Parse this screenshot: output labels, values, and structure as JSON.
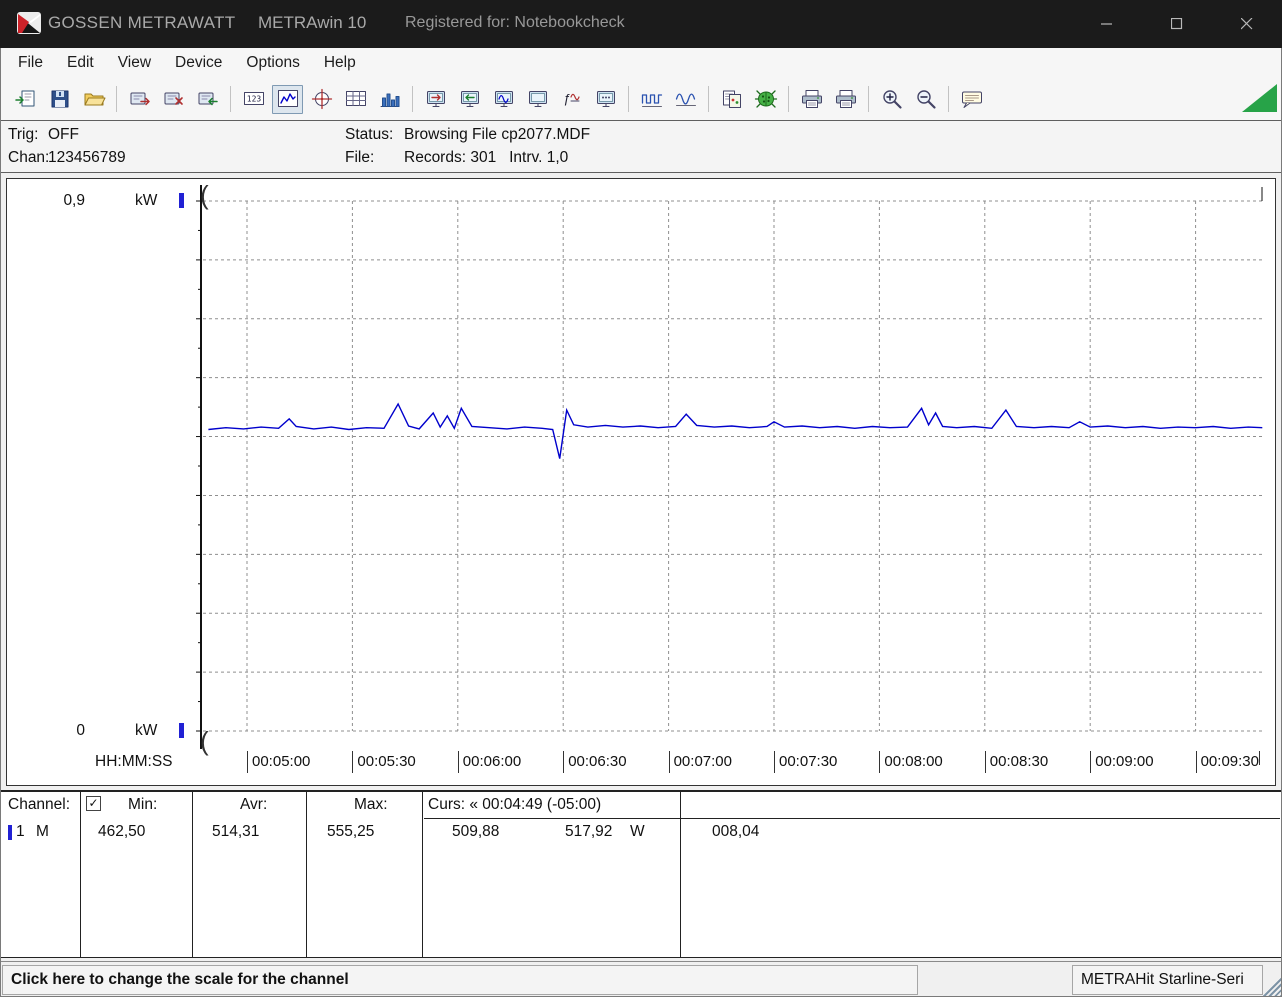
{
  "titlebar": {
    "brand": "GOSSEN METRAWATT",
    "app": "METRAwin 10",
    "registered": "Registered for: Notebookcheck",
    "controls": [
      "minimize",
      "maximize",
      "close"
    ]
  },
  "menu": {
    "items": [
      "File",
      "Edit",
      "View",
      "Device",
      "Options",
      "Help"
    ]
  },
  "toolbar": {
    "buttons": [
      {
        "name": "config-new-button",
        "icon": "doc_in"
      },
      {
        "name": "config-save-button",
        "icon": "floppy"
      },
      {
        "name": "file-open-button",
        "icon": "folder"
      },
      {
        "name": "data-export-button",
        "icon": "card_out",
        "sep_before": true
      },
      {
        "name": "data-delete-button",
        "icon": "card_x"
      },
      {
        "name": "data-import-button",
        "icon": "card_in"
      },
      {
        "name": "view-numeric-button",
        "icon": "numeric",
        "sep_before": true
      },
      {
        "name": "view-trend-chart-button",
        "icon": "chart_line",
        "pressed": true
      },
      {
        "name": "view-scope-button",
        "icon": "crosshair"
      },
      {
        "name": "view-table-button",
        "icon": "grid"
      },
      {
        "name": "view-histogram-button",
        "icon": "hist"
      },
      {
        "name": "device-send-button",
        "icon": "screen_arrow",
        "sep_before": true
      },
      {
        "name": "device-receive-button",
        "icon": "screen_in"
      },
      {
        "name": "device-monitor-button",
        "icon": "screen_wave"
      },
      {
        "name": "device-display-button",
        "icon": "screen"
      },
      {
        "name": "math-function-button",
        "icon": "fx"
      },
      {
        "name": "device-memory-button",
        "icon": "screen_mem"
      },
      {
        "name": "pulse-wave-button",
        "icon": "wave",
        "sep_before": true
      },
      {
        "name": "envelope-wave-button",
        "icon": "wave2"
      },
      {
        "name": "copy-clipboard-button",
        "icon": "clipboard",
        "sep_before": true
      },
      {
        "name": "live-mode-button",
        "icon": "beetle"
      },
      {
        "name": "print-preview-button",
        "icon": "printer",
        "sep_before": true
      },
      {
        "name": "print-button",
        "icon": "printer"
      },
      {
        "name": "zoom-in-button",
        "icon": "zoom_plus",
        "sep_before": true
      },
      {
        "name": "zoom-out-button",
        "icon": "zoom_minus"
      },
      {
        "name": "annotation-button",
        "icon": "note",
        "sep_before": true
      }
    ]
  },
  "status_panel": {
    "trig_label": "Trig:",
    "trig_value": "OFF",
    "chan_label": "Chan:",
    "chan_value": "123456789",
    "status_label": "Status:",
    "status_value": "Browsing File cp2077.MDF",
    "file_label": "File:",
    "file_value": "Records: 301   Intrv. 1,0"
  },
  "chart_data": {
    "type": "line",
    "title": "",
    "x_axis_label": "HH:MM:SS",
    "x_tick_labels": [
      "00:05:00",
      "00:05:30",
      "00:06:00",
      "00:06:30",
      "00:07:00",
      "00:07:30",
      "00:08:00",
      "00:08:30",
      "00:09:00",
      "00:09:30"
    ],
    "x_range_seconds": [
      289,
      589
    ],
    "grid": true,
    "y_axis": {
      "min": 0,
      "max": 0.9,
      "unit": "kW",
      "top_label": "0,9",
      "bottom_label": "0"
    },
    "series": [
      {
        "name": "Channel 1",
        "unit": "W",
        "color": "#0000cc",
        "stats": {
          "min_W": 462.5,
          "avg_W": 514.31,
          "max_W": 555.25
        },
        "t_seconds": [
          289,
          294,
          299,
          304,
          309,
          312,
          314,
          319,
          324,
          329,
          334,
          339,
          343,
          346,
          349,
          353,
          355,
          357,
          359,
          361,
          364,
          369,
          374,
          379,
          384,
          387,
          389,
          391,
          393,
          397,
          402,
          407,
          412,
          417,
          422,
          425,
          428,
          433,
          438,
          443,
          448,
          450,
          453,
          458,
          463,
          468,
          473,
          478,
          483,
          488,
          492,
          494,
          496,
          498,
          502,
          507,
          512,
          516,
          519,
          524,
          529,
          534,
          537,
          540,
          545,
          550,
          555,
          560,
          565,
          570,
          575,
          580,
          585,
          589
        ],
        "values_W": [
          512,
          515,
          513,
          516,
          514,
          530,
          517,
          513,
          516,
          512,
          515,
          514,
          555.25,
          518,
          513,
          540,
          516,
          535,
          514,
          548,
          517,
          515,
          513,
          516,
          514,
          512,
          462.5,
          545,
          520,
          516,
          519,
          516,
          518,
          515,
          517,
          538,
          519,
          516,
          518,
          515,
          517,
          525,
          516,
          518,
          515,
          517,
          514,
          517,
          515,
          516,
          548,
          520,
          540,
          517,
          515,
          517,
          514,
          545,
          517,
          515,
          517,
          515,
          525,
          516,
          518,
          515,
          517,
          514,
          516,
          515,
          517,
          514,
          516,
          515
        ]
      }
    ]
  },
  "table": {
    "col_channel": "Channel:",
    "col_min": "Min:",
    "col_avr": "Avr:",
    "col_max": "Max:",
    "col_cursor": "Curs: « 00:04:49 (-05:00)",
    "checkbox_checked": "✓",
    "row": {
      "channel": "1",
      "mode": "M",
      "min": "462,50",
      "avr": "514,31",
      "max": "555,25",
      "cursor_a": "509,88",
      "cursor_b": "517,92",
      "unit": "W",
      "delta": "008,04"
    }
  },
  "statusbar": {
    "hint": "Click here to change the scale for the channel",
    "device": "METRAHit Starline-Seri"
  }
}
